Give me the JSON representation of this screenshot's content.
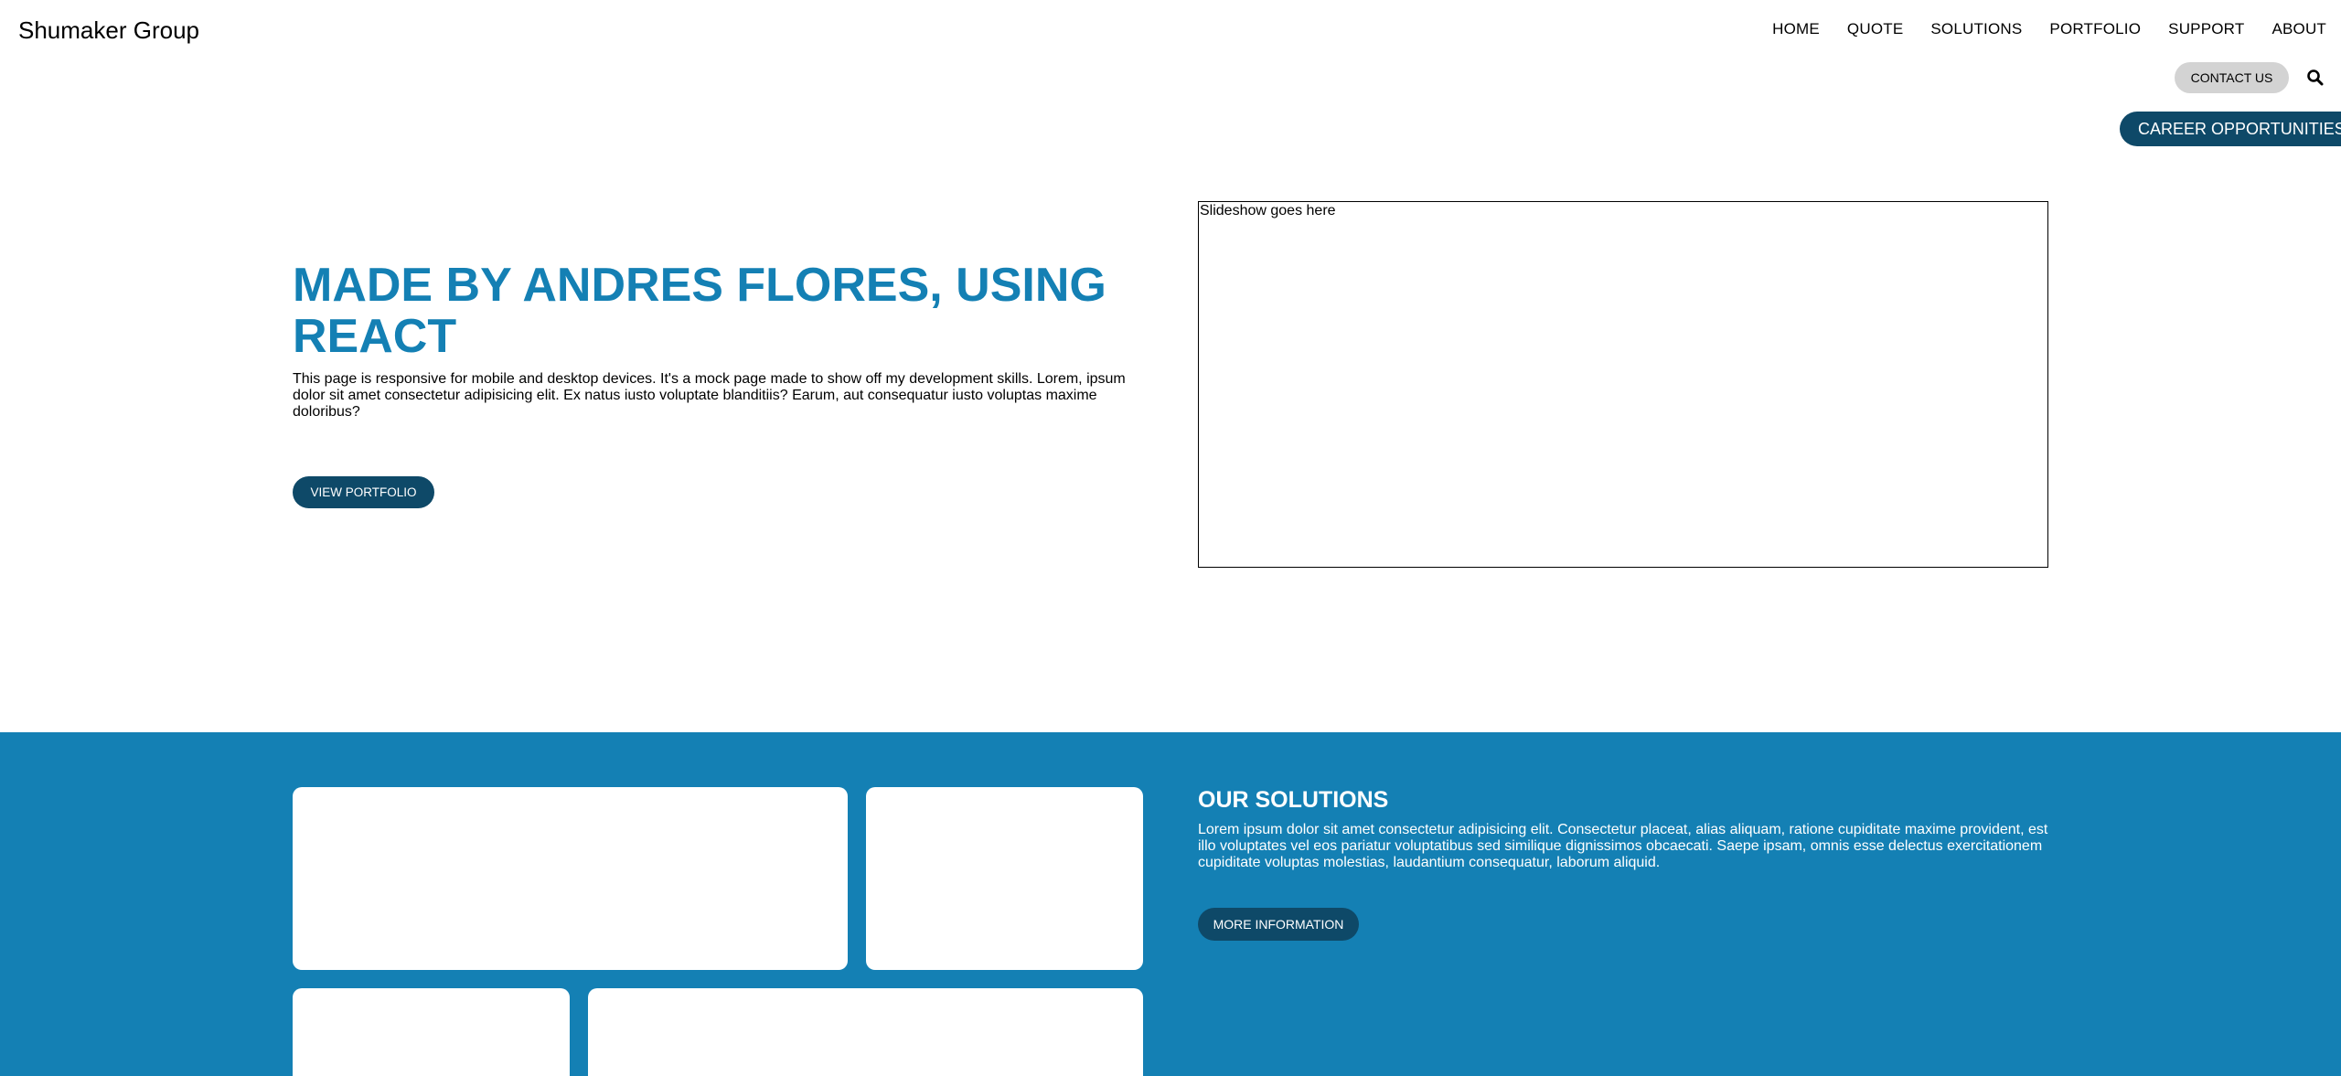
{
  "header": {
    "brand": "Shumaker Group",
    "nav": [
      "HOME",
      "QUOTE",
      "SOLUTIONS",
      "PORTFOLIO",
      "SUPPORT",
      "ABOUT"
    ],
    "contact_label": "CONTACT US",
    "search_icon": "search-icon",
    "career_label": "CAREER OPPORTUNITIES"
  },
  "hero": {
    "title": "MADE BY ANDRES FLORES, USING REACT",
    "text": "This page is responsive for mobile and desktop devices. It's a mock page made to show off my development skills. Lorem, ipsum dolor sit amet consectetur adipisicing elit. Ex natus iusto voluptate blanditiis? Earum, aut consequatur iusto voluptas maxime doloribus?",
    "button_label": "VIEW PORTFOLIO",
    "slideshow_placeholder": "Slideshow goes here"
  },
  "solutions": {
    "title": "OUR SOLUTIONS",
    "text": "Lorem ipsum dolor sit amet consectetur adipisicing elit. Consectetur placeat, alias aliquam, ratione cupiditate maxime provident, est illo voluptates vel eos pariatur voluptatibus sed similique dignissimos obcaecati. Saepe ipsam, omnis esse delectus exercitationem cupiditate voluptas molestias, laudantium consequatur, laborum aliquid.",
    "button_label": "MORE INFORMATION"
  },
  "colors": {
    "accent": "#1480b4",
    "dark_button": "#0e4968",
    "contact_button": "#d3d3d3"
  }
}
